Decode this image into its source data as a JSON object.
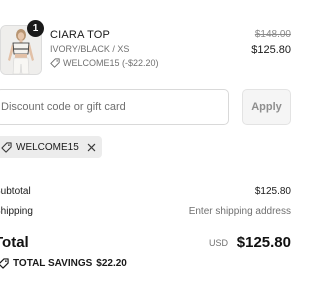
{
  "product": {
    "quantity": "1",
    "title": "CIARA TOP",
    "variant": "IVORY/BLACK / XS",
    "discount_note": "WELCOME15 (-$22.20)",
    "compare_price": "$148.00",
    "price": "$125.80"
  },
  "discount": {
    "placeholder": "Discount code or gift card",
    "apply_label": "Apply",
    "applied_code": "WELCOME15"
  },
  "summary": {
    "subtotal_label": "Subtotal",
    "subtotal_value": "$125.80",
    "shipping_label": "Shipping",
    "shipping_value": "Enter shipping address",
    "total_label": "Total",
    "total_currency": "USD",
    "total_value": "$125.80",
    "savings_label": "TOTAL SAVINGS",
    "savings_value": "$22.20"
  }
}
